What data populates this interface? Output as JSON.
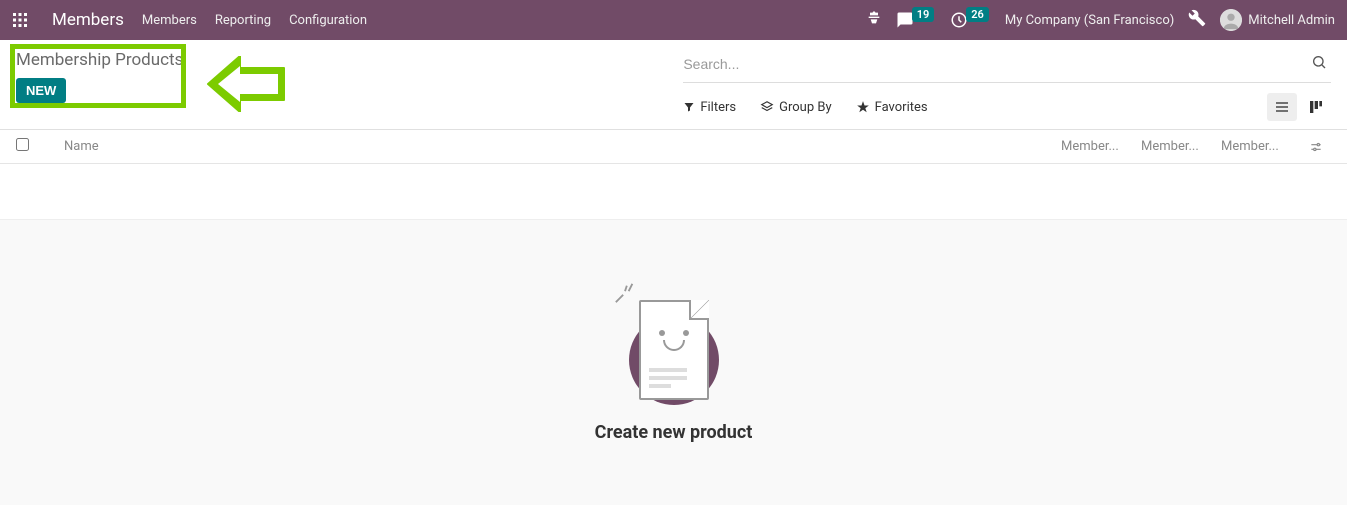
{
  "topbar": {
    "brand": "Members",
    "menu": [
      "Members",
      "Reporting",
      "Configuration"
    ],
    "messages_count": "19",
    "activities_count": "26",
    "company": "My Company (San Francisco)",
    "user": "Mitchell Admin"
  },
  "control_panel": {
    "breadcrumb": "Membership Products",
    "new_button": "NEW",
    "search_placeholder": "Search...",
    "filters_label": "Filters",
    "groupby_label": "Group By",
    "favorites_label": "Favorites"
  },
  "table": {
    "columns": [
      "Name",
      "Member...",
      "Member...",
      "Member..."
    ]
  },
  "empty": {
    "title": "Create new product"
  }
}
